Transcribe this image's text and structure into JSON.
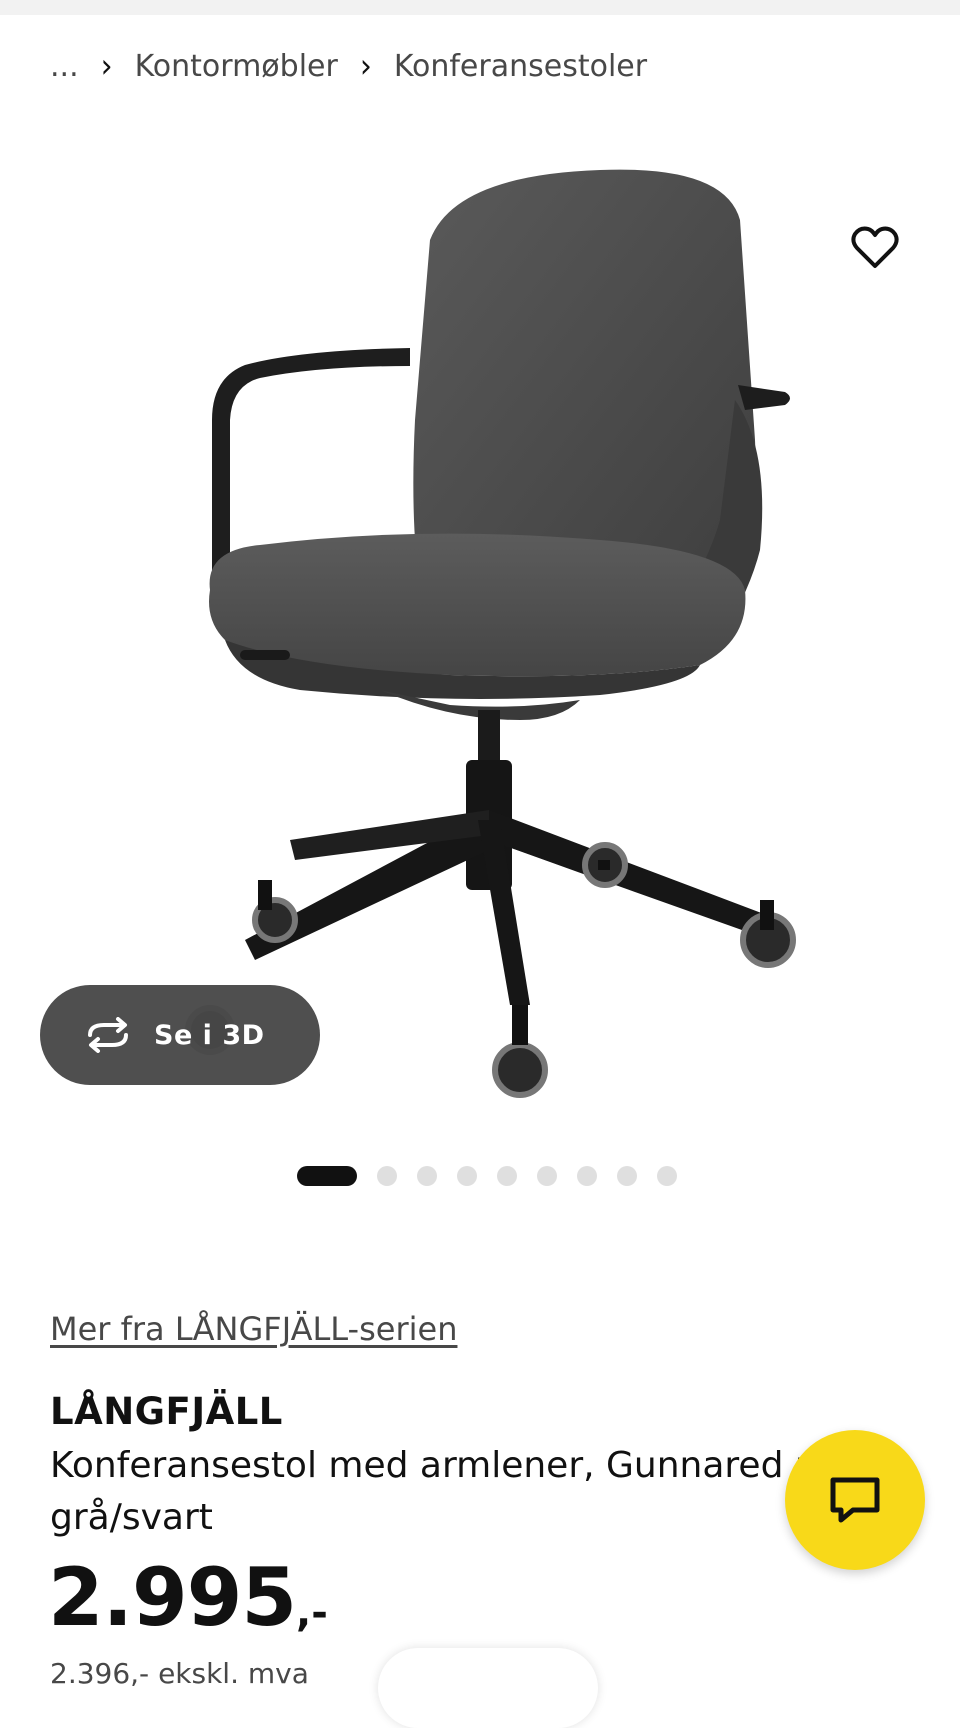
{
  "breadcrumb": {
    "ellipsis": "...",
    "items": [
      "Kontormøbler",
      "Konferansestoler"
    ]
  },
  "gallery": {
    "view_3d_label": "Se i 3D",
    "image_count": 9,
    "active_index": 1
  },
  "product": {
    "series_link": "Mer fra LÅNGFJÄLL-serien",
    "name": "LÅNGFJÄLL",
    "description": "Konferansestol med armlener, Gunnared mørk grå/svart",
    "price": "2.995",
    "price_suffix": ",-",
    "price_ex_vat": "2.396,- ekskl. mva"
  },
  "icons": {
    "favorite": "heart-icon",
    "view_3d": "rotate-3d-icon",
    "chat": "chat-bubble-icon",
    "breadcrumb_separator": "chevron-right-icon"
  },
  "colors": {
    "brand_yellow": "#f8d919",
    "text": "#111111",
    "muted": "#484848",
    "pill_dark": "#484848"
  }
}
